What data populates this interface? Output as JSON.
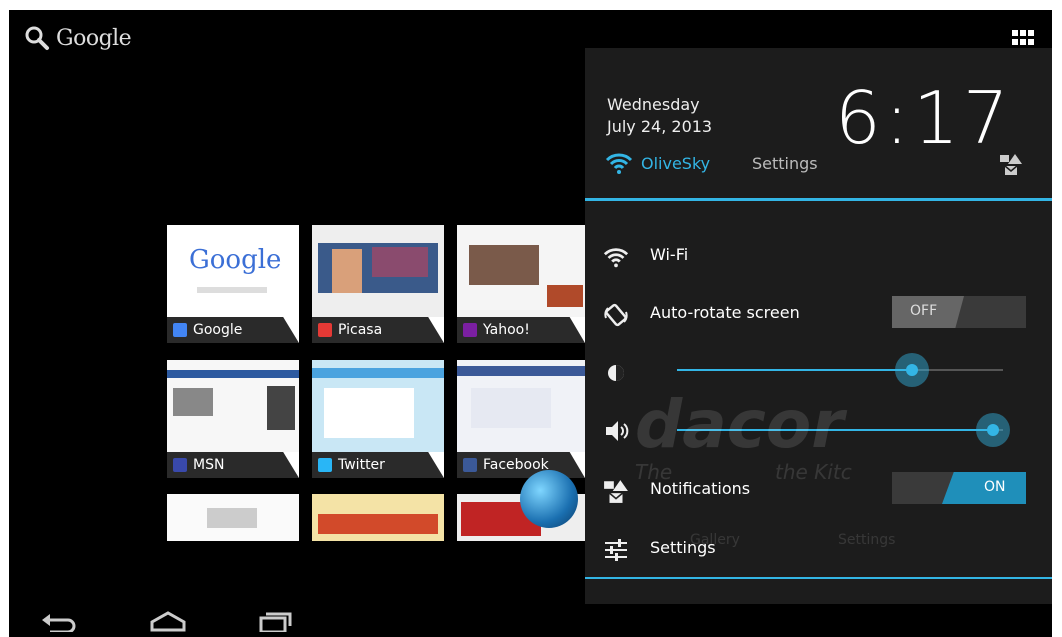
{
  "search": {
    "label": "Google"
  },
  "thumbnails": [
    {
      "label": "Google",
      "icon_color": "#4285f4"
    },
    {
      "label": "Picasa",
      "icon_color": "#e53935"
    },
    {
      "label": "Yahoo!",
      "icon_color": "#7b1fa2"
    },
    {
      "label": "MSN",
      "icon_color": "#3949ab"
    },
    {
      "label": "Twitter",
      "icon_color": "#29b6f6"
    },
    {
      "label": "Facebook",
      "icon_color": "#3b5998"
    }
  ],
  "panel": {
    "day": "Wednesday",
    "date": "July 24, 2013",
    "clock": "6:17",
    "network": "OliveSky",
    "settings_link": "Settings",
    "accent": "#33b5e5",
    "rows": {
      "wifi": "Wi-Fi",
      "autorotate": "Auto-rotate screen",
      "autorotate_state": "OFF",
      "notifications": "Notifications",
      "notifications_state": "ON",
      "settings": "Settings"
    },
    "brightness_level": 0.72,
    "volume_level": 0.97
  },
  "background": {
    "logo": "dacor",
    "tagline": "The",
    "tagline2": "the Kitc",
    "app1": "Gallery",
    "app2": "Settings"
  },
  "icons": {
    "search": "search-icon",
    "apps": "apps-grid-icon",
    "wifi": "wifi-icon",
    "rotate": "rotate-icon",
    "brightness": "brightness-icon",
    "volume": "volume-icon",
    "notification": "notification-icon",
    "settings": "settings-sliders-icon",
    "back": "back-icon",
    "home": "home-icon",
    "recents": "recents-icon"
  }
}
